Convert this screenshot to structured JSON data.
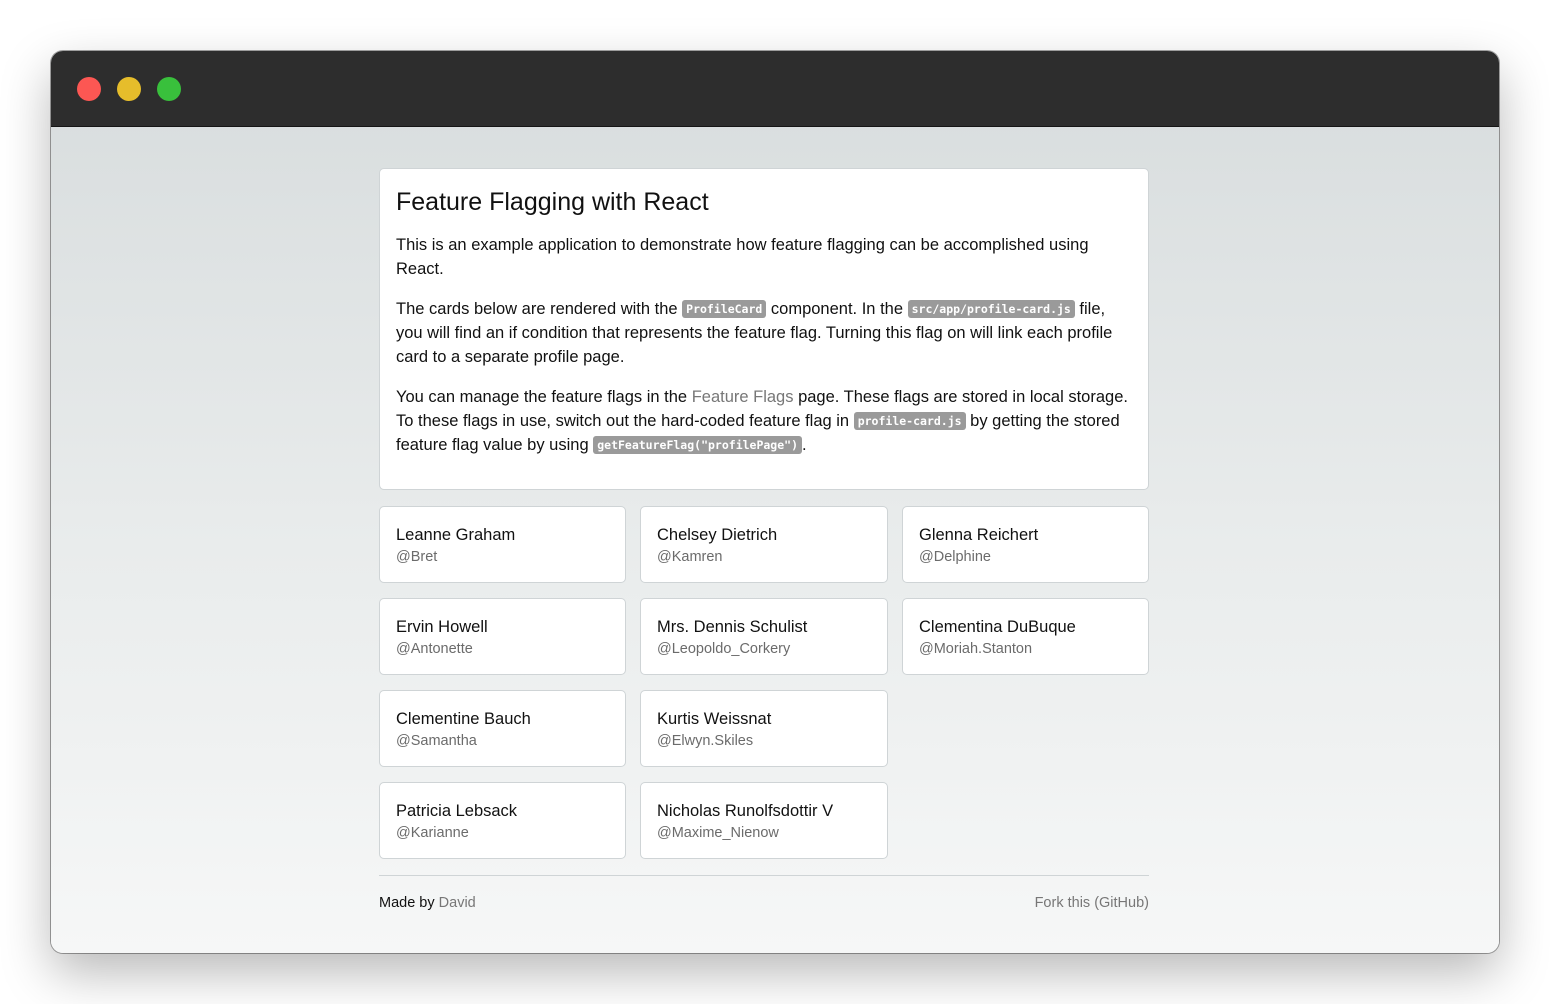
{
  "window": {
    "controls": [
      "close",
      "minimize",
      "maximize"
    ],
    "colors": {
      "close": "#fc5753",
      "minimize": "#e6bd2b",
      "maximize": "#39c03c"
    }
  },
  "intro": {
    "title": "Feature Flagging with React",
    "p1": "This is an example application to demonstrate how feature flagging can be accomplished using React.",
    "p2_a": "The cards below are rendered with the ",
    "p2_code1": "ProfileCard",
    "p2_b": " component. In the ",
    "p2_code2": "src/app/profile-card.js",
    "p2_c": " file, you will find an if condition that represents the feature flag. Turning this flag on will link each profile card to a separate profile page.",
    "p3_a": "You can manage the feature flags in the ",
    "p3_link": "Feature Flags",
    "p3_b": " page. These flags are stored in local storage. To these flags in use, switch out the hard-coded feature flag in ",
    "p3_code1": "profile-card.js",
    "p3_c": " by getting the stored feature flag value by using ",
    "p3_code2": "getFeatureFlag(\"profilePage\")",
    "p3_d": "."
  },
  "profiles": [
    {
      "name": "Leanne Graham",
      "handle": "@Bret"
    },
    {
      "name": "Chelsey Dietrich",
      "handle": "@Kamren"
    },
    {
      "name": "Glenna Reichert",
      "handle": "@Delphine"
    },
    {
      "name": "Ervin Howell",
      "handle": "@Antonette"
    },
    {
      "name": "Mrs. Dennis Schulist",
      "handle": "@Leopoldo_Corkery"
    },
    {
      "name": "Clementina DuBuque",
      "handle": "@Moriah.Stanton"
    },
    {
      "name": "Clementine Bauch",
      "handle": "@Samantha"
    },
    {
      "name": "Kurtis Weissnat",
      "handle": "@Elwyn.Skiles"
    },
    {
      "name": "Patricia Lebsack",
      "handle": "@Karianne"
    },
    {
      "name": "Nicholas Runolfsdottir V",
      "handle": "@Maxime_Nienow"
    }
  ],
  "footer": {
    "made_by": "Made by",
    "author": "David",
    "fork": "Fork this (GitHub)"
  }
}
